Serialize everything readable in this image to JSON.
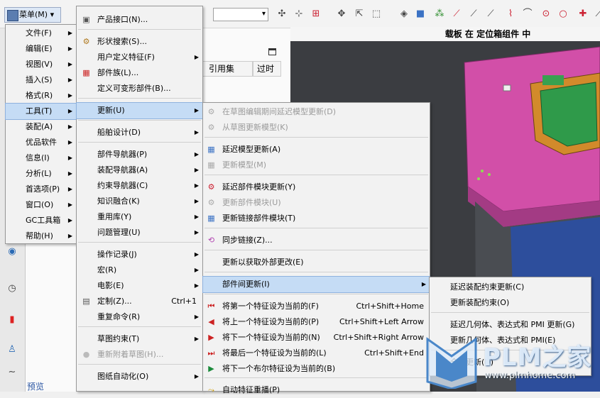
{
  "toolbar": {
    "menu_button": "菜单(M) ▾"
  },
  "viewport": {
    "title": "载板 在 定位箱组件 中"
  },
  "navigator": {
    "columns": [
      "引用集",
      "过时"
    ],
    "preview_tab": "预览"
  },
  "menu_main": {
    "items": [
      {
        "label": "文件(F)",
        "arrow": "▶"
      },
      {
        "label": "编辑(E)",
        "arrow": "▶"
      },
      {
        "label": "视图(V)",
        "arrow": "▶"
      },
      {
        "label": "插入(S)",
        "arrow": "▶"
      },
      {
        "label": "格式(R)",
        "arrow": "▶"
      },
      {
        "label": "工具(T)",
        "arrow": "▶"
      },
      {
        "label": "装配(A)",
        "arrow": "▶"
      },
      {
        "label": "优品软件",
        "arrow": "▶"
      },
      {
        "label": "信息(I)",
        "arrow": "▶"
      },
      {
        "label": "分析(L)",
        "arrow": "▶"
      },
      {
        "label": "首选项(P)",
        "arrow": "▶"
      },
      {
        "label": "窗口(O)",
        "arrow": "▶"
      },
      {
        "label": "GC工具箱",
        "arrow": "▶"
      },
      {
        "label": "帮助(H)",
        "arrow": "▶"
      }
    ]
  },
  "menu_tools": {
    "items": [
      {
        "label": "产品接口(N)...",
        "arrow": "",
        "shortcut": ""
      },
      {
        "label": "形状搜索(S)...",
        "arrow": "",
        "shortcut": ""
      },
      {
        "label": "用户定义特征(F)",
        "arrow": "▶",
        "shortcut": ""
      },
      {
        "label": "部件族(L)...",
        "arrow": "",
        "shortcut": ""
      },
      {
        "label": "定义可变形部件(B)...",
        "arrow": "",
        "shortcut": ""
      },
      {
        "label": "更新(U)",
        "arrow": "▶",
        "shortcut": ""
      },
      {
        "label": "船舶设计(D)",
        "arrow": "▶",
        "shortcut": ""
      },
      {
        "label": "部件导航器(P)",
        "arrow": "▶",
        "shortcut": ""
      },
      {
        "label": "装配导航器(A)",
        "arrow": "▶",
        "shortcut": ""
      },
      {
        "label": "约束导航器(C)",
        "arrow": "▶",
        "shortcut": ""
      },
      {
        "label": "知识融合(K)",
        "arrow": "▶",
        "shortcut": ""
      },
      {
        "label": "重用库(Y)",
        "arrow": "▶",
        "shortcut": ""
      },
      {
        "label": "问题管理(U)",
        "arrow": "▶",
        "shortcut": ""
      },
      {
        "label": "操作记录(J)",
        "arrow": "▶",
        "shortcut": ""
      },
      {
        "label": "宏(R)",
        "arrow": "▶",
        "shortcut": ""
      },
      {
        "label": "电影(E)",
        "arrow": "▶",
        "shortcut": ""
      },
      {
        "label": "定制(Z)...",
        "arrow": "",
        "shortcut": "Ctrl+1"
      },
      {
        "label": "重复命令(R)",
        "arrow": "▶",
        "shortcut": ""
      },
      {
        "label": "草图约束(T)",
        "arrow": "▶",
        "shortcut": ""
      },
      {
        "label": "重新附着草图(H)...",
        "arrow": "",
        "shortcut": ""
      },
      {
        "label": "图纸自动化(O)",
        "arrow": "▶",
        "shortcut": ""
      }
    ]
  },
  "menu_update": {
    "items": [
      {
        "label": "在草图编辑期间延迟模型更新(D)",
        "shortcut": "",
        "arrow": ""
      },
      {
        "label": "从草图更新模型(K)",
        "shortcut": "",
        "arrow": ""
      },
      {
        "label": "延迟模型更新(A)",
        "shortcut": "",
        "arrow": ""
      },
      {
        "label": "更新模型(M)",
        "shortcut": "",
        "arrow": ""
      },
      {
        "label": "延迟部件模块更新(Y)",
        "shortcut": "",
        "arrow": ""
      },
      {
        "label": "更新部件模块(U)",
        "shortcut": "",
        "arrow": ""
      },
      {
        "label": "更新链接部件模块(T)",
        "shortcut": "",
        "arrow": ""
      },
      {
        "label": "同步链接(Z)...",
        "shortcut": "",
        "arrow": ""
      },
      {
        "label": "更新以获取外部更改(E)",
        "shortcut": "",
        "arrow": ""
      },
      {
        "label": "部件间更新(I)",
        "shortcut": "",
        "arrow": "▶"
      },
      {
        "label": "将第一个特征设为当前的(F)",
        "shortcut": "Ctrl+Shift+Home",
        "arrow": ""
      },
      {
        "label": "将上一个特征设为当前的(P)",
        "shortcut": "Ctrl+Shift+Left Arrow",
        "arrow": ""
      },
      {
        "label": "将下一个特征设为当前的(N)",
        "shortcut": "Ctrl+Shift+Right Arrow",
        "arrow": ""
      },
      {
        "label": "将最后一个特征设为当前的(L)",
        "shortcut": "Ctrl+Shift+End",
        "arrow": ""
      },
      {
        "label": "将下一个布尔特征设为当前的(B)",
        "shortcut": "",
        "arrow": ""
      },
      {
        "label": "自动特征重播(P)",
        "shortcut": "",
        "arrow": ""
      }
    ]
  },
  "menu_interpart": {
    "items": [
      {
        "label": "延迟装配约束更新(C)"
      },
      {
        "label": "更新装配约束(O)"
      },
      {
        "label": "延迟几何体、表达式和 PMI 更新(G)"
      },
      {
        "label": "更新几何体、表达式和 PMI(E)"
      },
      {
        "label": "全部更新(D)"
      }
    ]
  },
  "watermark": {
    "brand": "PLM之家",
    "url": "www.plmhome.com"
  }
}
